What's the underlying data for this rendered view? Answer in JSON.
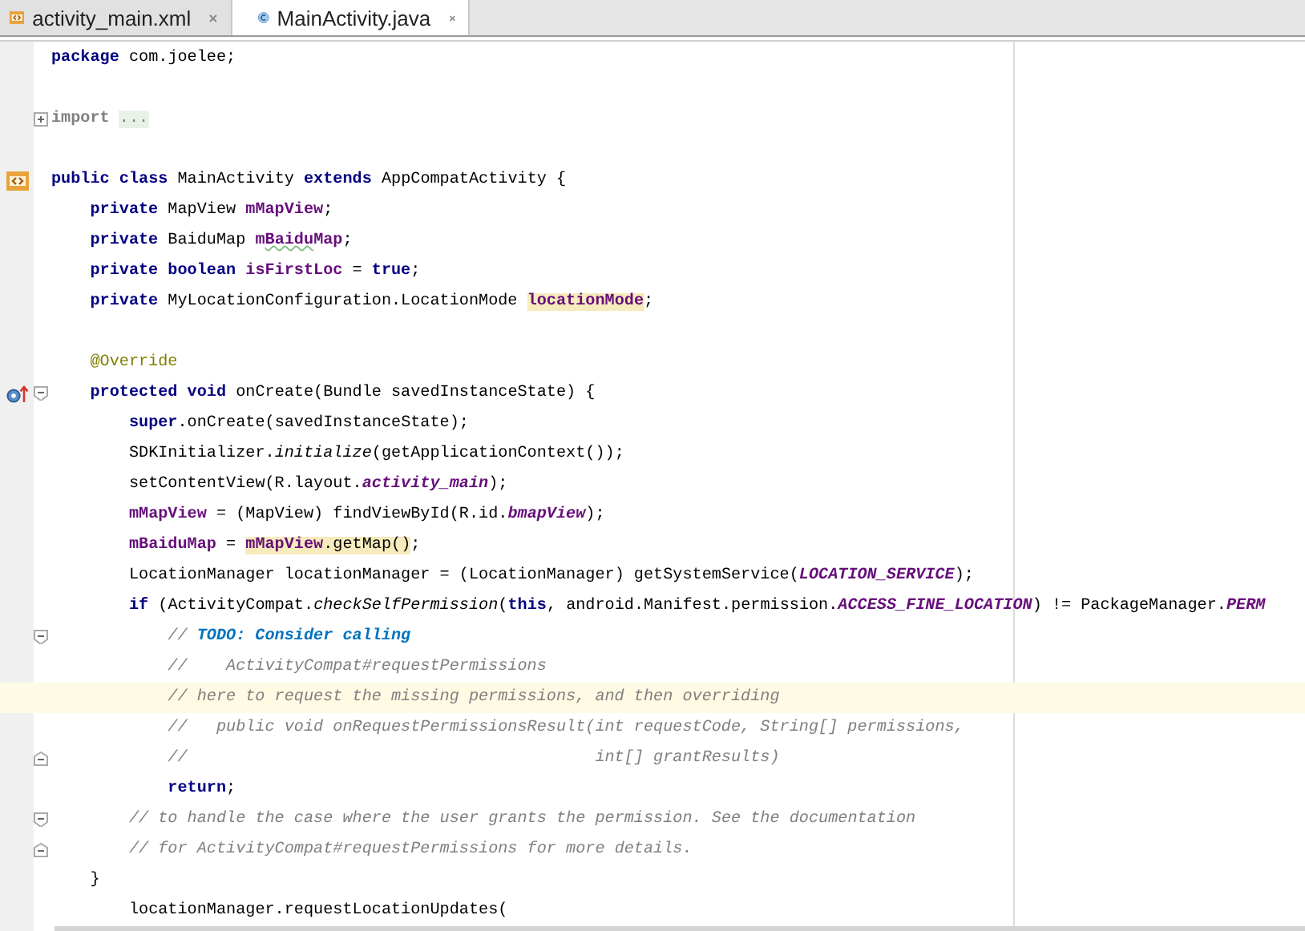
{
  "tabs": [
    {
      "label": "activity_main.xml",
      "selected": false,
      "kind": "xml"
    },
    {
      "label": "MainActivity.java",
      "selected": true,
      "kind": "class"
    }
  ],
  "editor": {
    "lines": [
      {
        "kind": "code",
        "tokens": [
          {
            "text": "package",
            "kind": "keyword"
          },
          {
            "text": " com.joelee;",
            "kind": "plain"
          }
        ]
      },
      {
        "kind": "blank"
      },
      {
        "kind": "code",
        "fold_collapsed": true,
        "tokens": [
          {
            "text": "import ",
            "kind": "folded"
          },
          {
            "text": "...",
            "kind": "placeholder"
          }
        ]
      },
      {
        "kind": "blank"
      },
      {
        "kind": "code",
        "class_marker": true,
        "tokens": [
          {
            "text": "public class",
            "kind": "keyword"
          },
          {
            "text": " MainActivity ",
            "kind": "plain"
          },
          {
            "text": "extends",
            "kind": "keyword"
          },
          {
            "text": " AppCompatActivity {",
            "kind": "plain"
          }
        ]
      },
      {
        "kind": "code",
        "tokens": [
          {
            "text": "    private",
            "kind": "keyword"
          },
          {
            "text": " MapView ",
            "kind": "plain"
          },
          {
            "text": "mMapView",
            "kind": "field"
          },
          {
            "text": ";",
            "kind": "plain"
          }
        ]
      },
      {
        "kind": "code",
        "tokens": [
          {
            "text": "    private",
            "kind": "keyword"
          },
          {
            "text": " BaiduMap ",
            "kind": "plain"
          },
          {
            "text": "m",
            "kind": "field"
          },
          {
            "text": "Baidu",
            "kind": "field",
            "typo": true
          },
          {
            "text": "Map",
            "kind": "field"
          },
          {
            "text": ";",
            "kind": "plain"
          }
        ]
      },
      {
        "kind": "code",
        "tokens": [
          {
            "text": "    private boolean ",
            "kind": "keyword"
          },
          {
            "text": "isFirstLoc",
            "kind": "field"
          },
          {
            "text": " = ",
            "kind": "plain"
          },
          {
            "text": "true",
            "kind": "keyword"
          },
          {
            "text": ";",
            "kind": "plain"
          }
        ]
      },
      {
        "kind": "code",
        "tokens": [
          {
            "text": "    private",
            "kind": "keyword"
          },
          {
            "text": " MyLocationConfiguration.LocationMode ",
            "kind": "plain"
          },
          {
            "text": "locationMode",
            "kind": "field",
            "highlight": true
          },
          {
            "text": ";",
            "kind": "plain"
          }
        ]
      },
      {
        "kind": "blank"
      },
      {
        "kind": "code",
        "tokens": [
          {
            "text": "    @Override",
            "kind": "annotation"
          }
        ]
      },
      {
        "kind": "code",
        "override_marker": true,
        "fold_start": true,
        "tokens": [
          {
            "text": "    protected void",
            "kind": "keyword"
          },
          {
            "text": " onCreate(Bundle savedInstanceState) {",
            "kind": "plain"
          }
        ]
      },
      {
        "kind": "code",
        "tokens": [
          {
            "text": "        super",
            "kind": "keyword"
          },
          {
            "text": ".onCreate(savedInstanceState);",
            "kind": "plain"
          }
        ]
      },
      {
        "kind": "code",
        "tokens": [
          {
            "text": "        SDKInitializer.",
            "kind": "plain"
          },
          {
            "text": "initialize",
            "kind": "static_method"
          },
          {
            "text": "(getApplicationContext());",
            "kind": "plain"
          }
        ]
      },
      {
        "kind": "code",
        "tokens": [
          {
            "text": "        setContentView(R.layout.",
            "kind": "plain"
          },
          {
            "text": "activity_main",
            "kind": "static_field"
          },
          {
            "text": ");",
            "kind": "plain"
          }
        ]
      },
      {
        "kind": "code",
        "tokens": [
          {
            "text": "        mMapView",
            "kind": "field"
          },
          {
            "text": " = (MapView) findViewById(R.id.",
            "kind": "plain"
          },
          {
            "text": "bmapView",
            "kind": "static_field"
          },
          {
            "text": ");",
            "kind": "plain"
          }
        ]
      },
      {
        "kind": "code",
        "tokens": [
          {
            "text": "        mBaiduMap",
            "kind": "field"
          },
          {
            "text": " = ",
            "kind": "plain"
          },
          {
            "text": "mMapView",
            "kind": "field",
            "highlight": true
          },
          {
            "text": ".getMap()",
            "kind": "plain",
            "highlight": true
          },
          {
            "text": ";",
            "kind": "plain"
          }
        ]
      },
      {
        "kind": "code",
        "tokens": [
          {
            "text": "        LocationManager locationManager = (LocationManager) getSystemService(",
            "kind": "plain"
          },
          {
            "text": "LOCATION_SERVICE",
            "kind": "static_field"
          },
          {
            "text": ");",
            "kind": "plain"
          }
        ]
      },
      {
        "kind": "code",
        "tokens": [
          {
            "text": "        if",
            "kind": "keyword"
          },
          {
            "text": " (ActivityCompat.",
            "kind": "plain"
          },
          {
            "text": "checkSelfPermission",
            "kind": "static_method"
          },
          {
            "text": "(",
            "kind": "plain"
          },
          {
            "text": "this",
            "kind": "keyword"
          },
          {
            "text": ", android.Manifest.permission.",
            "kind": "plain"
          },
          {
            "text": "ACCESS_FINE_LOCATION",
            "kind": "static_field"
          },
          {
            "text": ") != PackageManager.",
            "kind": "plain"
          },
          {
            "text": "PERM",
            "kind": "static_field"
          }
        ]
      },
      {
        "kind": "code",
        "fold_start": true,
        "tokens": [
          {
            "text": "            // ",
            "kind": "comment"
          },
          {
            "text": "TODO: Consider calling",
            "kind": "todo"
          }
        ]
      },
      {
        "kind": "code",
        "tokens": [
          {
            "text": "            //    ActivityCompat#requestPermissions",
            "kind": "comment"
          }
        ]
      },
      {
        "kind": "code",
        "current": true,
        "tokens": [
          {
            "text": "            // here to request the missing permissions, and then overriding",
            "kind": "comment"
          }
        ]
      },
      {
        "kind": "code",
        "tokens": [
          {
            "text": "            //   public void onRequestPermissionsResult(int requestCode, String[] permissions,",
            "kind": "comment"
          }
        ]
      },
      {
        "kind": "code",
        "fold_end": true,
        "tokens": [
          {
            "text": "            //                                          int[] grantResults)",
            "kind": "comment"
          }
        ]
      },
      {
        "kind": "code",
        "tokens": [
          {
            "text": "            return",
            "kind": "keyword"
          },
          {
            "text": ";",
            "kind": "plain"
          }
        ]
      },
      {
        "kind": "code",
        "fold_start": true,
        "tokens": [
          {
            "text": "        // to handle the case where the user grants the permission. See the documentation",
            "kind": "comment"
          }
        ]
      },
      {
        "kind": "code",
        "fold_end": true,
        "tokens": [
          {
            "text": "        // for ActivityCompat#requestPermissions for more details.",
            "kind": "comment"
          }
        ]
      },
      {
        "kind": "code",
        "tokens": [
          {
            "text": "    }",
            "kind": "plain"
          }
        ]
      },
      {
        "kind": "code",
        "tokens": [
          {
            "text": "        locationManager.requestLocationUpdates(",
            "kind": "plain"
          }
        ]
      }
    ]
  }
}
